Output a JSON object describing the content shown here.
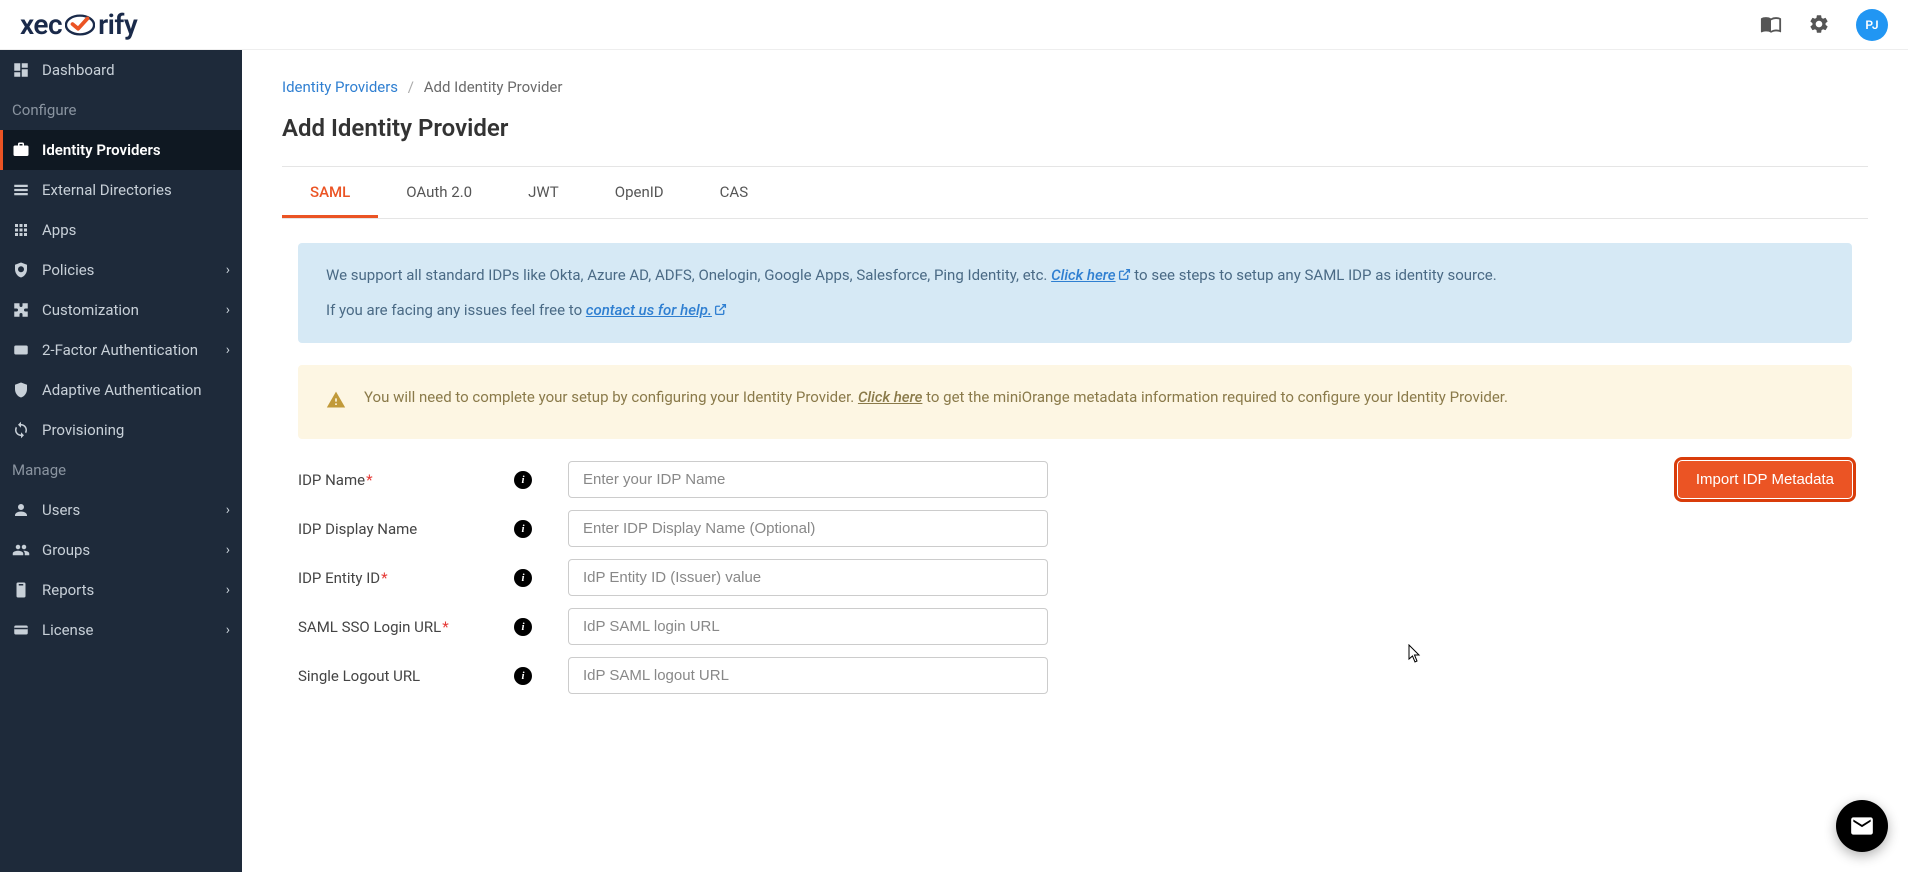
{
  "header": {
    "logo_part1": "xec",
    "logo_part2": "rify",
    "avatar_initials": "PJ"
  },
  "sidebar": {
    "section_configure": "Configure",
    "section_manage": "Manage",
    "items": [
      {
        "label": "Dashboard",
        "expandable": false
      },
      {
        "label": "Identity Providers",
        "expandable": false
      },
      {
        "label": "External Directories",
        "expandable": false
      },
      {
        "label": "Apps",
        "expandable": false
      },
      {
        "label": "Policies",
        "expandable": true
      },
      {
        "label": "Customization",
        "expandable": true
      },
      {
        "label": "2-Factor Authentication",
        "expandable": true
      },
      {
        "label": "Adaptive Authentication",
        "expandable": false
      },
      {
        "label": "Provisioning",
        "expandable": false
      },
      {
        "label": "Users",
        "expandable": true
      },
      {
        "label": "Groups",
        "expandable": true
      },
      {
        "label": "Reports",
        "expandable": true
      },
      {
        "label": "License",
        "expandable": true
      }
    ]
  },
  "breadcrumb": {
    "link": "Identity Providers",
    "current": "Add Identity Provider"
  },
  "page": {
    "title": "Add Identity Provider"
  },
  "tabs": [
    {
      "label": "SAML"
    },
    {
      "label": "OAuth 2.0"
    },
    {
      "label": "JWT"
    },
    {
      "label": "OpenID"
    },
    {
      "label": "CAS"
    }
  ],
  "info_alert": {
    "text1a": "We support all standard IDPs like Okta, Azure AD, ADFS, Onelogin, Google Apps, Salesforce, Ping Identity, etc. ",
    "link1": "Click here",
    "text1b": " to see steps to setup any SAML IDP as identity source.",
    "text2a": "If you are facing any issues feel free to ",
    "link2": "contact us for help."
  },
  "warning_alert": {
    "text1a": "You will need to complete your setup by configuring your Identity Provider. ",
    "link1": "Click here",
    "text1b": " to get the miniOrange metadata information required to configure your Identity Provider."
  },
  "form": {
    "rows": [
      {
        "label": "IDP Name",
        "required": true,
        "placeholder": "Enter your IDP Name"
      },
      {
        "label": "IDP Display Name",
        "required": false,
        "placeholder": "Enter IDP Display Name (Optional)"
      },
      {
        "label": "IDP Entity ID",
        "required": true,
        "placeholder": "IdP Entity ID (Issuer) value"
      },
      {
        "label": "SAML SSO Login URL",
        "required": true,
        "placeholder": "IdP SAML login URL"
      },
      {
        "label": "Single Logout URL",
        "required": false,
        "placeholder": "IdP SAML logout URL"
      }
    ],
    "import_button": "Import IDP Metadata"
  },
  "colors": {
    "accent": "#eb5424",
    "sidebar_bg": "#1e2a3a",
    "info_bg": "#d6e9f5",
    "warning_bg": "#fdf6e3",
    "link": "#2f7fd1"
  }
}
